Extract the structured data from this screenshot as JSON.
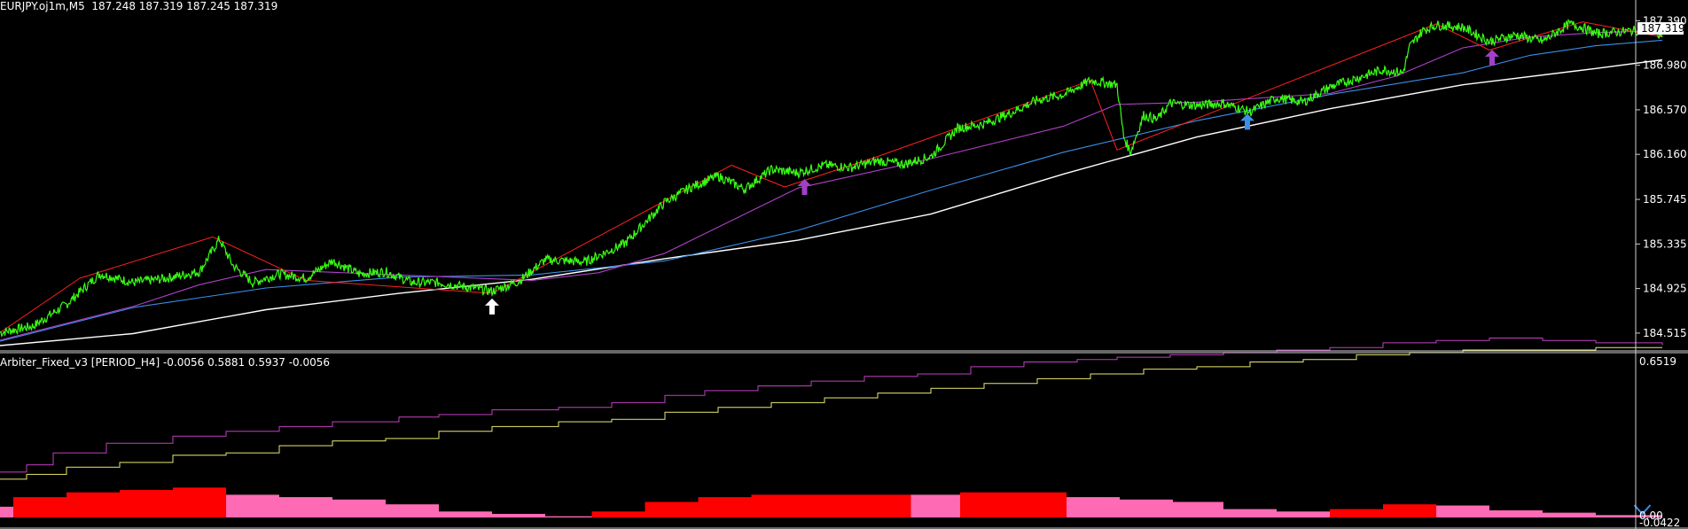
{
  "main_header": "EURJPY.oj1m,M5  187.248 187.319 187.245 187.319",
  "sub_header": "Arbiter_Fixed_v3 [PERIOD_H4] -0.0056 0.5881 0.5937 -0.0056",
  "colors": {
    "background": "#000000",
    "price": "#39ff14",
    "ma_purple": "#b040c8",
    "ma_blue": "#3a8fe8",
    "ma_white": "#ffffff",
    "zigzag": "#ff2020",
    "hist_red": "#ff0000",
    "hist_pink": "#ff6ab4",
    "sub_magenta": "#c040c0",
    "sub_yellow": "#e8e870",
    "arrow_white": "#ffffff",
    "arrow_purple": "#a040c8",
    "arrow_blue": "#3a8fe8"
  },
  "chart_data": [
    {
      "type": "line",
      "title": "EURJPY.oj1m,M5",
      "ylim": [
        184.4,
        187.45
      ],
      "price_axis_labels": [
        "187.390",
        "186.980",
        "186.570",
        "186.160",
        "185.745",
        "185.335",
        "184.925",
        "184.515"
      ],
      "current_price_label": "187.319",
      "series": [
        {
          "name": "price",
          "x": [
            0,
            25,
            50,
            75,
            100,
            125,
            150,
            165,
            175,
            190,
            210,
            230,
            250,
            270,
            290,
            310,
            330,
            350,
            370,
            390,
            410,
            440,
            470,
            500,
            520,
            540,
            560,
            580,
            600,
            620,
            640,
            660,
            680,
            700,
            720,
            740,
            760,
            780,
            800,
            820,
            840,
            845,
            850,
            860,
            870,
            880,
            900,
            920,
            940,
            960,
            980,
            1000,
            1020,
            1040,
            1055,
            1060,
            1070,
            1080,
            1100,
            1120,
            1140,
            1160,
            1180,
            1190,
            1200,
            1220,
            1240,
            1250
          ],
          "values": [
            184.52,
            184.58,
            184.78,
            185.06,
            184.98,
            185.02,
            185.08,
            185.38,
            185.14,
            184.98,
            185.06,
            185.02,
            185.18,
            185.06,
            185.08,
            184.98,
            184.98,
            184.94,
            184.9,
            184.99,
            185.19,
            185.17,
            185.34,
            185.72,
            185.86,
            185.96,
            185.84,
            186.02,
            185.99,
            186.06,
            186.04,
            186.1,
            186.07,
            186.14,
            186.4,
            186.44,
            186.54,
            186.66,
            186.71,
            186.84,
            186.8,
            186.32,
            186.18,
            186.52,
            186.48,
            186.63,
            186.61,
            186.63,
            186.55,
            186.68,
            186.64,
            186.78,
            186.86,
            186.94,
            186.91,
            187.15,
            187.3,
            187.35,
            187.33,
            187.2,
            187.26,
            187.2,
            187.36,
            187.33,
            187.27,
            187.29,
            187.31,
            187.24
          ]
        },
        {
          "name": "ma_purple",
          "x": [
            0,
            100,
            150,
            200,
            300,
            400,
            450,
            500,
            600,
            700,
            800,
            840,
            900,
            1000,
            1050,
            1100,
            1150,
            1200,
            1250
          ],
          "values": [
            184.45,
            184.76,
            184.96,
            185.1,
            185.05,
            185.0,
            185.07,
            185.25,
            185.85,
            186.12,
            186.42,
            186.62,
            186.64,
            186.72,
            186.88,
            187.14,
            187.24,
            187.28,
            187.3
          ]
        },
        {
          "name": "ma_blue",
          "x": [
            0,
            100,
            200,
            300,
            400,
            500,
            600,
            700,
            800,
            900,
            1000,
            1100,
            1150,
            1200,
            1250
          ],
          "values": [
            184.44,
            184.75,
            184.93,
            185.03,
            185.05,
            185.18,
            185.46,
            185.83,
            186.18,
            186.47,
            186.71,
            186.91,
            187.07,
            187.16,
            187.21
          ]
        },
        {
          "name": "ma_white",
          "x": [
            0,
            100,
            200,
            300,
            400,
            500,
            600,
            700,
            800,
            900,
            1000,
            1100,
            1200,
            1250
          ],
          "values": [
            184.4,
            184.51,
            184.73,
            184.88,
            185.01,
            185.2,
            185.37,
            185.61,
            185.98,
            186.32,
            186.58,
            186.8,
            186.95,
            187.03
          ]
        },
        {
          "name": "zigzag",
          "x": [
            0,
            60,
            160,
            230,
            370,
            550,
            590,
            660,
            820,
            840,
            1080,
            1120,
            1190,
            1250
          ],
          "values": [
            184.52,
            185.02,
            185.4,
            185.0,
            184.88,
            186.06,
            185.86,
            186.14,
            186.84,
            186.2,
            187.36,
            187.12,
            187.38,
            187.24
          ]
        }
      ],
      "arrows": [
        {
          "x": 370,
          "price": 184.76,
          "color": "white",
          "direction": "up"
        },
        {
          "x": 605,
          "price": 185.86,
          "color": "purple",
          "direction": "up"
        },
        {
          "x": 938,
          "price": 186.46,
          "color": "blue",
          "direction": "up"
        },
        {
          "x": 1122,
          "price": 187.05,
          "color": "purple",
          "direction": "up"
        }
      ]
    },
    {
      "type": "bar",
      "title": "Arbiter_Fixed_v3 [PERIOD_H4]",
      "ylim": [
        0,
        0.6519
      ],
      "axis_labels": [
        "0.6519",
        "0.00",
        "-0.0422"
      ],
      "histogram": {
        "edges": [
          0,
          10,
          50,
          90,
          130,
          170,
          210,
          250,
          290,
          330,
          370,
          410,
          445,
          485,
          525,
          565,
          605,
          645,
          685,
          722,
          762,
          802,
          842,
          882,
          920,
          960,
          1000,
          1040,
          1080,
          1120,
          1160,
          1200,
          1250
        ],
        "values": [
          0.045,
          0.085,
          0.105,
          0.115,
          0.125,
          0.095,
          0.085,
          0.075,
          0.055,
          0.025,
          0.015,
          0.005,
          0.025,
          0.065,
          0.085,
          0.095,
          0.095,
          0.095,
          0.095,
          0.105,
          0.105,
          0.085,
          0.075,
          0.065,
          0.035,
          0.025,
          0.035,
          0.055,
          0.05,
          0.03,
          0.02,
          0.01
        ],
        "colors": [
          "pink",
          "red",
          "red",
          "red",
          "red",
          "pink",
          "pink",
          "pink",
          "pink",
          "pink",
          "pink",
          "pink",
          "red",
          "red",
          "red",
          "red",
          "red",
          "red",
          "pink",
          "red",
          "red",
          "pink",
          "pink",
          "pink",
          "pink",
          "pink",
          "red",
          "red",
          "pink",
          "pink",
          "pink",
          "pink"
        ]
      },
      "series": [
        {
          "name": "magenta_step",
          "x": [
            0,
            20,
            40,
            80,
            130,
            170,
            210,
            250,
            300,
            330,
            370,
            420,
            460,
            500,
            530,
            570,
            610,
            650,
            690,
            730,
            770,
            810,
            840,
            880,
            920,
            960,
            1000,
            1040,
            1080,
            1120,
            1160,
            1200,
            1250
          ],
          "values": [
            0.19,
            0.22,
            0.27,
            0.31,
            0.34,
            0.36,
            0.38,
            0.4,
            0.42,
            0.43,
            0.45,
            0.46,
            0.48,
            0.51,
            0.53,
            0.55,
            0.57,
            0.59,
            0.6,
            0.63,
            0.65,
            0.66,
            0.67,
            0.68,
            0.69,
            0.7,
            0.71,
            0.73,
            0.74,
            0.75,
            0.74,
            0.73,
            0.72
          ]
        },
        {
          "name": "yellow_step",
          "x": [
            0,
            20,
            50,
            90,
            130,
            170,
            210,
            250,
            290,
            330,
            370,
            420,
            460,
            500,
            540,
            580,
            620,
            660,
            700,
            740,
            780,
            820,
            860,
            900,
            940,
            980,
            1020,
            1060,
            1100,
            1150,
            1200,
            1250
          ],
          "values": [
            0.16,
            0.18,
            0.21,
            0.23,
            0.26,
            0.27,
            0.3,
            0.32,
            0.33,
            0.36,
            0.38,
            0.4,
            0.41,
            0.44,
            0.46,
            0.48,
            0.5,
            0.52,
            0.54,
            0.56,
            0.58,
            0.6,
            0.62,
            0.63,
            0.65,
            0.66,
            0.68,
            0.69,
            0.7,
            0.7,
            0.71,
            0.71
          ]
        }
      ]
    }
  ]
}
